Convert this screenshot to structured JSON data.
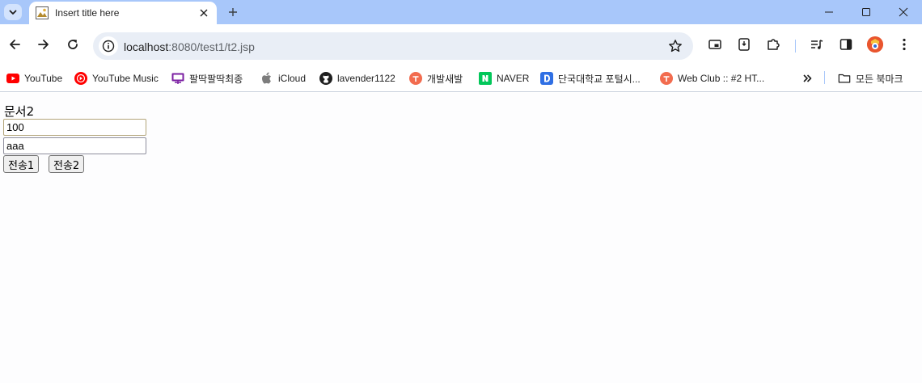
{
  "tab": {
    "title": "Insert title here"
  },
  "address_bar": {
    "host": "localhost",
    "rest": ":8080/test1/t2.jsp"
  },
  "bookmarks": [
    {
      "label": "YouTube",
      "icon": "youtube-icon"
    },
    {
      "label": "YouTube Music",
      "icon": "youtube-music-icon"
    },
    {
      "label": "팔딱팔딱최종",
      "icon": "presentation-icon"
    },
    {
      "label": "iCloud",
      "icon": "apple-icon"
    },
    {
      "label": "lavender1122",
      "icon": "github-icon"
    },
    {
      "label": "개발새발",
      "icon": "tistory-icon"
    },
    {
      "label": "NAVER",
      "icon": "naver-icon"
    },
    {
      "label": "단국대학교 포털시...",
      "icon": "d-icon"
    },
    {
      "label": "Web Club :: #2 HT...",
      "icon": "tistory-icon"
    }
  ],
  "all_bookmarks": {
    "label": "모든 북마크"
  },
  "page": {
    "title": "문서2",
    "field1_value": "100",
    "field2_value": "aaa",
    "submit1_label": "전송1",
    "submit2_label": "전송2"
  },
  "colors": {
    "titlebar": "#a8c7fa",
    "omnibox": "#e9eef6",
    "youtube": "#ff0000",
    "naver": "#03c75a",
    "tistory": "#f26c4f"
  }
}
